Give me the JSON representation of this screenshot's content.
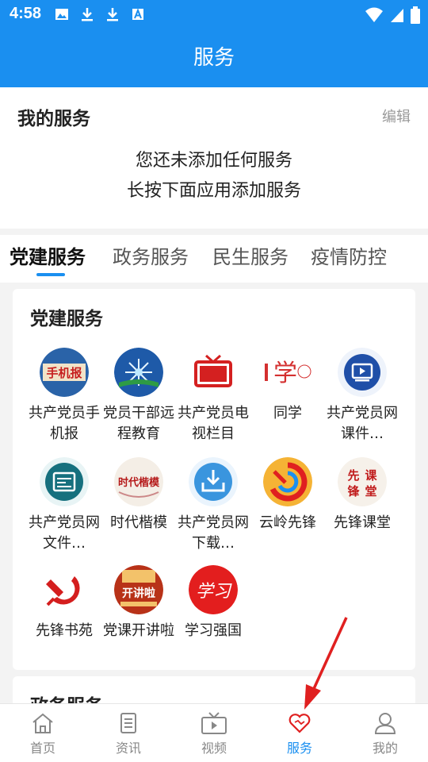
{
  "status": {
    "time": "4:58"
  },
  "header": {
    "title": "服务"
  },
  "my_service": {
    "title": "我的服务",
    "edit_label": "编辑",
    "empty_line1": "您还未添加任何服务",
    "empty_line2": "长按下面应用添加服务"
  },
  "tabs": [
    {
      "label": "党建服务"
    },
    {
      "label": "政务服务"
    },
    {
      "label": "民生服务"
    },
    {
      "label": "疫情防控"
    }
  ],
  "party_section": {
    "title": "党建服务",
    "items": [
      {
        "label": "共产党员手机报",
        "icon": "mobile-newspaper-icon"
      },
      {
        "label": "党员干部远程教育",
        "icon": "remote-education-icon"
      },
      {
        "label": "共产党员电视栏目",
        "icon": "tv-icon"
      },
      {
        "label": "同学",
        "icon": "tongxue-icon"
      },
      {
        "label": "共产党员网课件…",
        "icon": "video-courseware-icon"
      },
      {
        "label": "共产党员网文件…",
        "icon": "document-icon"
      },
      {
        "label": "时代楷模",
        "icon": "role-model-icon"
      },
      {
        "label": "共产党员网下载…",
        "icon": "download-icon"
      },
      {
        "label": "云岭先锋",
        "icon": "yunling-icon"
      },
      {
        "label": "先锋课堂",
        "icon": "pioneer-class-icon"
      },
      {
        "label": "先锋书苑",
        "icon": "party-emblem-icon"
      },
      {
        "label": "党课开讲啦",
        "icon": "party-lecture-icon"
      },
      {
        "label": "学习强国",
        "icon": "xuexi-icon"
      }
    ]
  },
  "gov_section": {
    "title": "政务服务"
  },
  "bottom_nav": [
    {
      "label": "首页",
      "icon": "home-icon"
    },
    {
      "label": "资讯",
      "icon": "news-icon"
    },
    {
      "label": "视频",
      "icon": "video-icon"
    },
    {
      "label": "服务",
      "icon": "heart-icon"
    },
    {
      "label": "我的",
      "icon": "user-icon"
    }
  ],
  "colors": {
    "primary": "#1a8ff0",
    "accent_red": "#e02020"
  }
}
